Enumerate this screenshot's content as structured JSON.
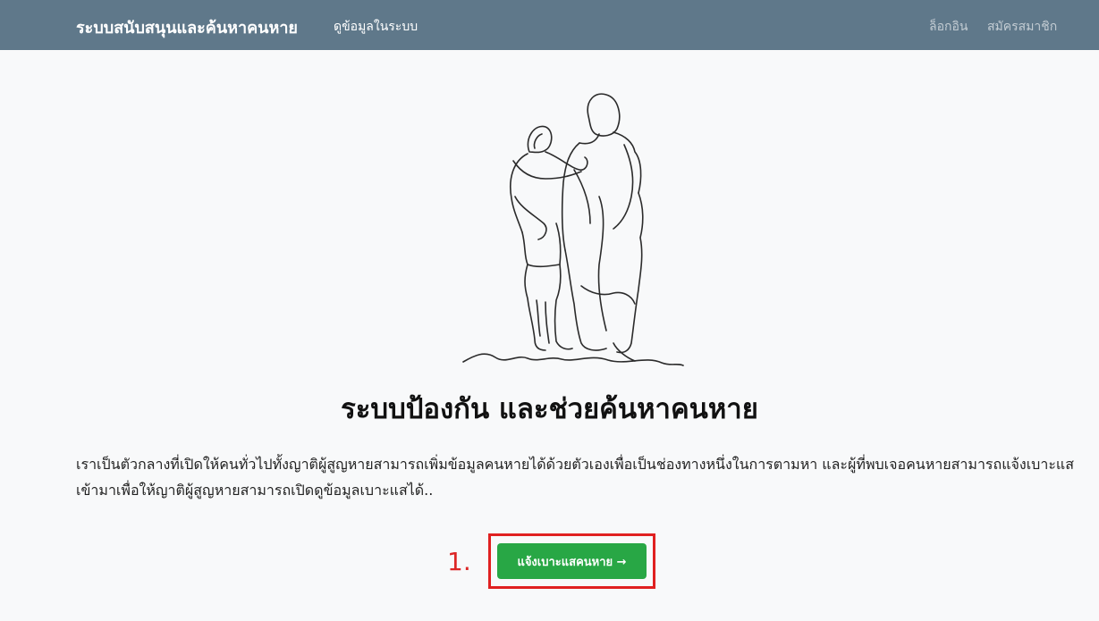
{
  "navbar": {
    "brand": "ระบบสนับสนุนและค้นหาคนหาย",
    "data_link": "ดูข้อมูลในระบบ",
    "login": "ล็อกอิน",
    "register": "สมัครสมาชิก",
    "background_color": "#5f788a"
  },
  "hero": {
    "illustration": "line-art-parent-and-child",
    "title": "ระบบป้องกัน และช่วยค้นหาคนหาย",
    "description": "เราเป็นตัวกลางที่เปิดให้คนทั่วไปทั้งญาติผู้สูญหายสามารถเพิ่มข้อมูลคนหายได้ด้วยตัวเองเพื่อเป็นช่องทางหนึ่งในการตามหา และผู้ที่พบเจอคนหายสามารถแจ้งเบาะแสเข้ามาเพื่อให้ญาติผู้สูญหายสามารถเปิดดูข้อมูลเบาะแสได้..",
    "step_number": "1.",
    "report_button": "แจ้งเบาะแสคนหาย →",
    "button_color": "#28a745",
    "highlight_color": "#e02020"
  }
}
